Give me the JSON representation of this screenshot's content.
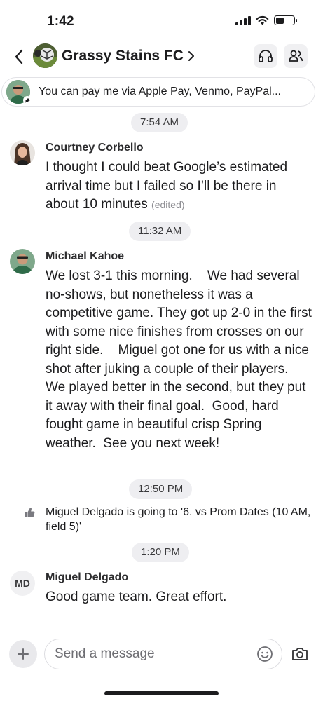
{
  "status_bar": {
    "time": "1:42"
  },
  "header": {
    "group_name": "Grassy Stains FC",
    "chevron": "chevron-right-icon",
    "buttons": [
      "headphones-icon",
      "members-icon"
    ]
  },
  "pinned": {
    "text": "You can pay me via Apple Pay, Venmo, PayPal..."
  },
  "timeline": {
    "t1": "7:54 AM",
    "t2": "11:32 AM",
    "t3": "12:50 PM",
    "t4": "1:20 PM"
  },
  "messages": [
    {
      "sender": "Courtney Corbello",
      "text": "I thought I could beat Google’s estimated arrival time but I failed so I’ll be there in about 10 minutes",
      "edited": "(edited)"
    },
    {
      "sender": "Michael Kahoe",
      "text": "We lost 3-1 this morning.    We had several no-shows, but nonetheless it was a competitive game. They got up 2-0 in the first with some nice finishes from crosses on our right side.    Miguel got one for us with a nice shot after juking a couple of their players.  We played better in the second, but they put it away with their final goal.  Good, hard fought game in beautiful crisp Spring weather.  See you next week!"
    },
    {
      "sender": "Miguel Delgado",
      "initials": "MD",
      "text": "Good game team. Great effort."
    }
  ],
  "event": {
    "text": "Miguel Delgado is going to '6. vs Prom Dates (10 AM, field 5)'"
  },
  "composer": {
    "placeholder": "Send a message"
  },
  "colors": {
    "pill_bg": "#eeeef1",
    "text": "#1c1c1e",
    "muted": "#8e8e93"
  }
}
